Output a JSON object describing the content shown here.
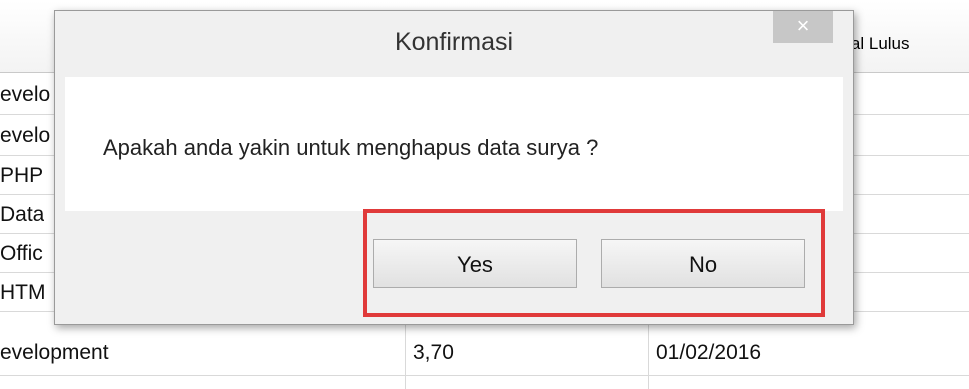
{
  "table": {
    "header_label": "ggal Lulus",
    "rows": [
      {
        "col1": "evelo",
        "col2": "",
        "col3": ""
      },
      {
        "col1": "evelo",
        "col2": "",
        "col3": ""
      },
      {
        "col1": "PHP",
        "col2": "",
        "col3": ""
      },
      {
        "col1": "Data",
        "col2": "",
        "col3": ""
      },
      {
        "col1": "Offic",
        "col2": "",
        "col3": ""
      },
      {
        "col1": "HTM",
        "col2": "",
        "col3": ""
      },
      {
        "col1": "evelopment",
        "col2": "3,70",
        "col3": "01/02/2016"
      }
    ]
  },
  "dialog": {
    "title": "Konfirmasi",
    "close_glyph": "×",
    "message": "Apakah anda yakin untuk menghapus data surya ?",
    "yes_label": "Yes",
    "no_label": "No"
  },
  "colors": {
    "highlight": "#e03a3a",
    "close_button": "#c7c7c7"
  }
}
